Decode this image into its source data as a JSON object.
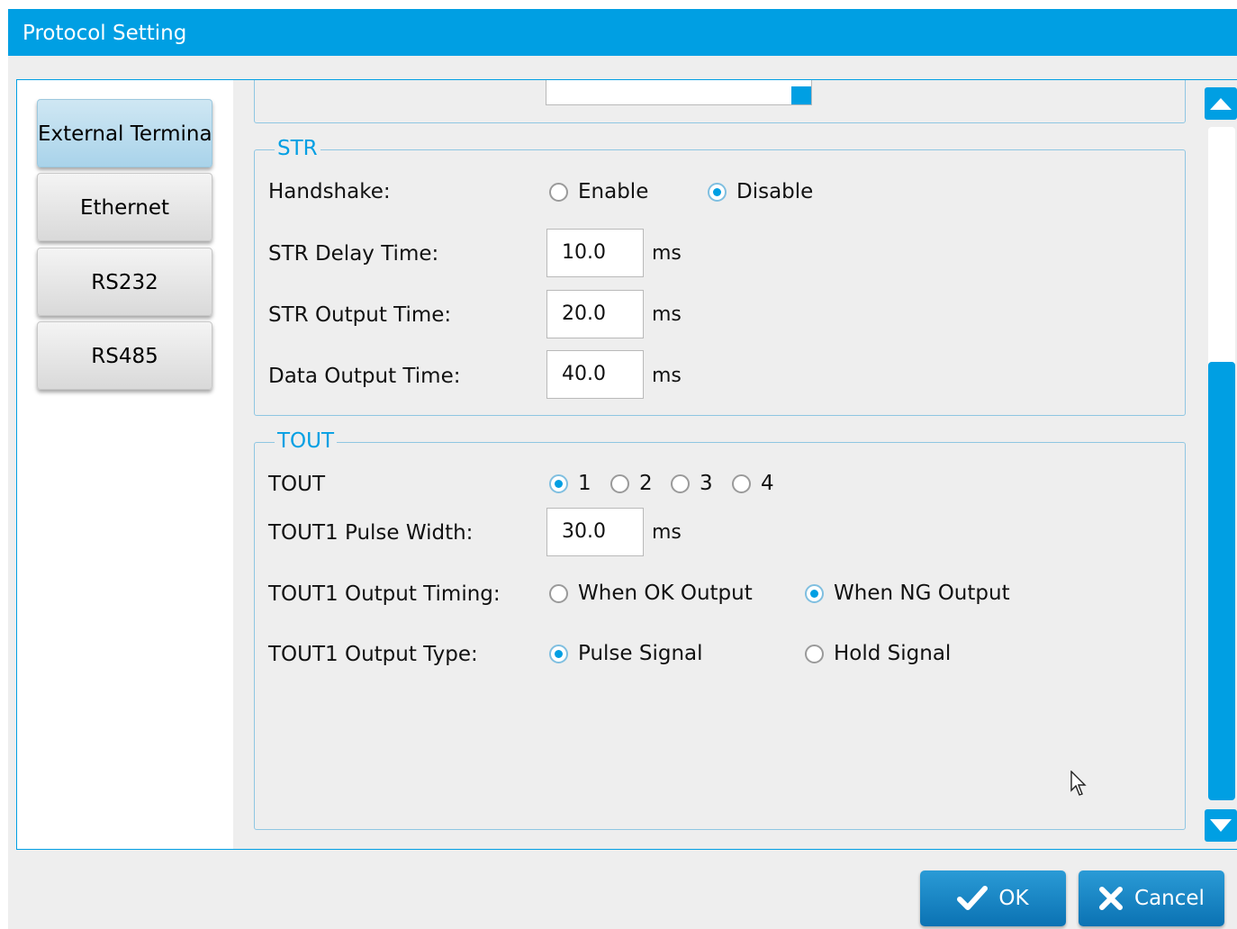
{
  "window": {
    "title": "Protocol Setting"
  },
  "nav": {
    "items": [
      {
        "label": "External Terminal",
        "active": true
      },
      {
        "label": "Ethernet",
        "active": false
      },
      {
        "label": "RS232",
        "active": false
      },
      {
        "label": "RS485",
        "active": false
      }
    ]
  },
  "str_group": {
    "legend": "STR",
    "handshake": {
      "label": "Handshake:",
      "options": [
        "Enable",
        "Disable"
      ],
      "selected": "Disable"
    },
    "delay": {
      "label": "STR Delay Time:",
      "value": "10.0",
      "unit": "ms"
    },
    "output": {
      "label": "STR Output Time:",
      "value": "20.0",
      "unit": "ms"
    },
    "data_output": {
      "label": "Data Output Time:",
      "value": "40.0",
      "unit": "ms"
    }
  },
  "tout_group": {
    "legend": "TOUT",
    "tout": {
      "label": "TOUT",
      "options": [
        "1",
        "2",
        "3",
        "4"
      ],
      "selected": "1"
    },
    "pulse_width": {
      "label": "TOUT1 Pulse Width:",
      "value": "30.0",
      "unit": "ms"
    },
    "timing": {
      "label": "TOUT1 Output Timing:",
      "options": [
        "When OK Output",
        "When NG Output"
      ],
      "selected": "When NG Output"
    },
    "type": {
      "label": "TOUT1 Output Type:",
      "options": [
        "Pulse Signal",
        "Hold Signal"
      ],
      "selected": "Pulse Signal"
    }
  },
  "buttons": {
    "ok": "OK",
    "cancel": "Cancel"
  },
  "scrollbar": {
    "position": 0.95
  },
  "colors": {
    "accent": "#009fe3",
    "background": "#eeeeee"
  },
  "icons": [
    "scroll-up-icon",
    "scroll-down-icon",
    "check-icon",
    "cross-icon"
  ]
}
